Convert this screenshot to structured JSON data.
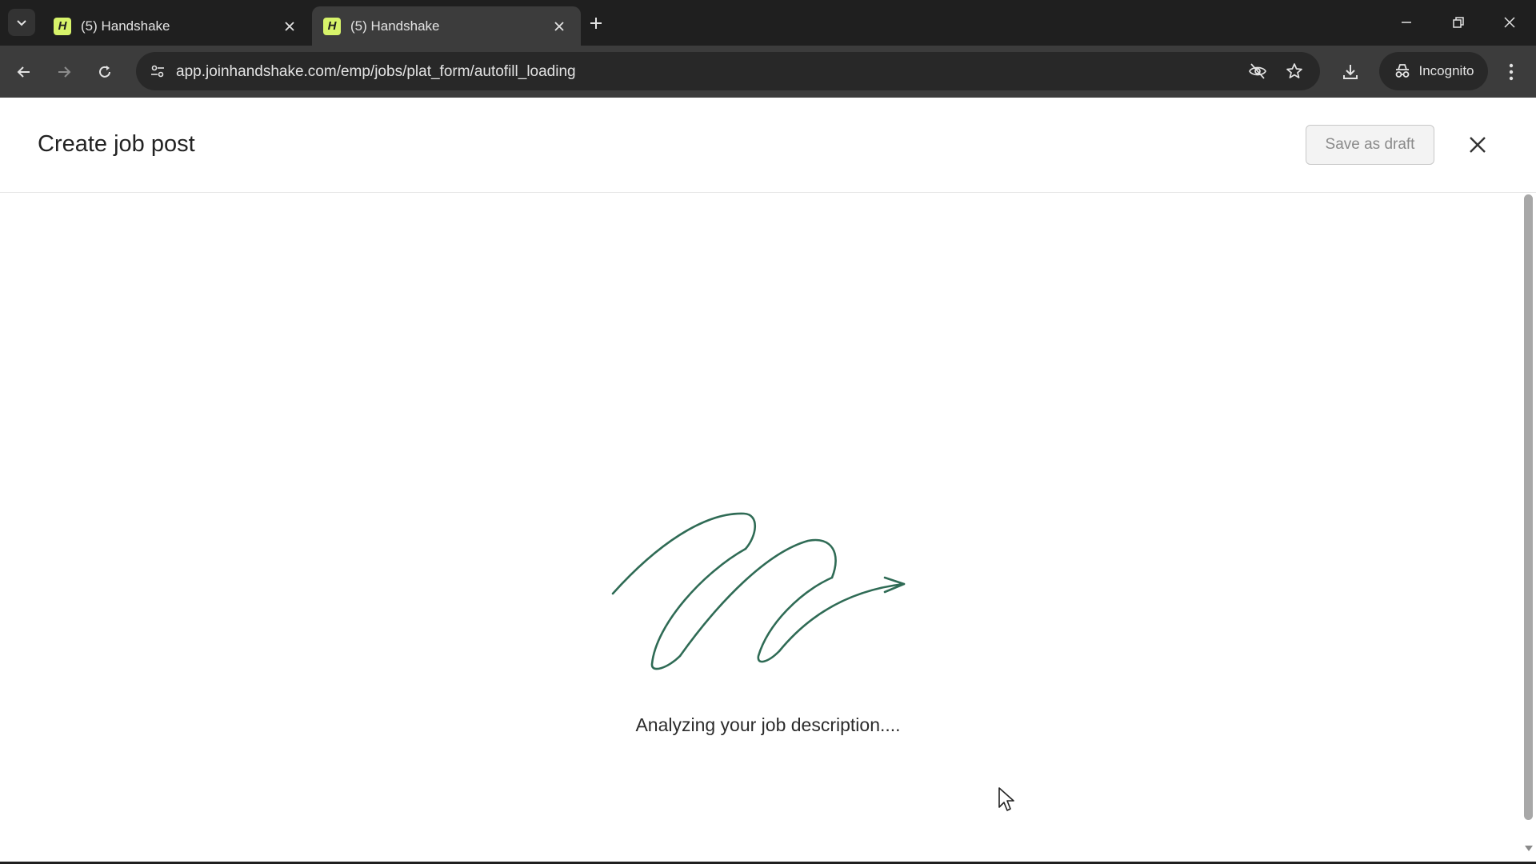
{
  "browser": {
    "tabs": [
      {
        "title": "(5) Handshake",
        "active": false,
        "favicon": "handshake-logo"
      },
      {
        "title": "(5) Handshake",
        "active": true,
        "favicon": "handshake-logo"
      }
    ],
    "favicon_letter": "H",
    "url": "app.joinhandshake.com/emp/jobs/plat_form/autofill_loading",
    "incognito_label": "Incognito"
  },
  "page": {
    "title": "Create job post",
    "save_draft_label": "Save as draft",
    "status_text": "Analyzing your job description...."
  },
  "colors": {
    "chrome_dark": "#1f1f1f",
    "chrome_toolbar": "#3c3c3c",
    "favicon_bg": "#d7f36a",
    "loader_stroke": "#2f6b55"
  },
  "icons": {
    "tab_search": "chevron-down-icon",
    "tab_close": "close-icon",
    "new_tab": "plus-icon",
    "back": "arrow-left-icon",
    "forward": "arrow-right-icon",
    "reload": "reload-icon",
    "site_info": "tune-icon",
    "tracking": "eye-slash-icon",
    "bookmark": "star-icon",
    "downloads": "download-icon",
    "menu": "kebab-icon",
    "page_close": "close-icon"
  }
}
